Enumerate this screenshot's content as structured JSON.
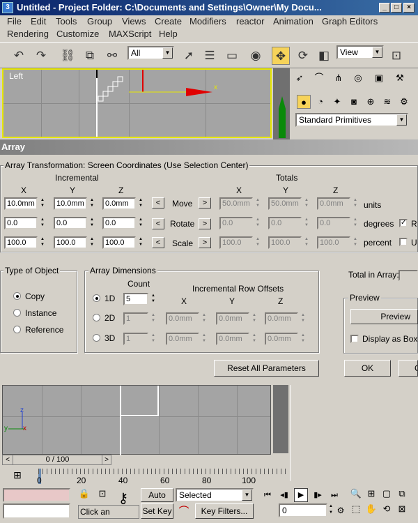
{
  "window": {
    "title": "Untitled    - Project Folder: C:\\Documents and Settings\\Owner\\My Docu..."
  },
  "menu": [
    "File",
    "Edit",
    "Tools",
    "Group",
    "Views",
    "Create",
    "Modifiers",
    "reactor",
    "Animation",
    "Graph Editors",
    "Rendering",
    "Customize",
    "MAXScript",
    "Help"
  ],
  "toolbar": {
    "selection_filter": "All",
    "ref_coord": "View"
  },
  "viewport_top": {
    "label": "Left"
  },
  "command_panel": {
    "dropdown": "Standard Primitives"
  },
  "dialog": {
    "title": "Array",
    "transform_group": "Array Transformation: Screen Coordinates (Use Selection Center)",
    "incremental_label": "Incremental",
    "totals_label": "Totals",
    "axes": [
      "X",
      "Y",
      "Z"
    ],
    "rows": [
      {
        "label": "Move",
        "inc": [
          "10.0mm",
          "10.0mm",
          "0.0mm"
        ],
        "tot": [
          "50.0mm",
          "50.0mm",
          "0.0mm"
        ],
        "unit": "units"
      },
      {
        "label": "Rotate",
        "inc": [
          "0.0",
          "0.0",
          "0.0"
        ],
        "tot": [
          "0.0",
          "0.0",
          "0.0"
        ],
        "unit": "degrees"
      },
      {
        "label": "Scale",
        "inc": [
          "100.0",
          "100.0",
          "100.0"
        ],
        "tot": [
          "100.0",
          "100.0",
          "100.0"
        ],
        "unit": "percent"
      }
    ],
    "re_orient_label": "R",
    "uniform_label": "U",
    "type_group": "Type of Object",
    "type_options": [
      "Copy",
      "Instance",
      "Reference"
    ],
    "dims_group": "Array Dimensions",
    "count_label": "Count",
    "row_offsets_label": "Incremental Row Offsets",
    "dims": [
      {
        "label": "1D",
        "count": "5"
      },
      {
        "label": "2D",
        "count": "1",
        "x": "0.0mm",
        "y": "0.0mm",
        "z": "0.0mm"
      },
      {
        "label": "3D",
        "count": "1",
        "x": "0.0mm",
        "y": "0.0mm",
        "z": "0.0mm"
      }
    ],
    "total_in_array": "Total in Array:",
    "preview_group": "Preview",
    "preview_button": "Preview",
    "display_as_box": "Display as Box",
    "reset_button": "Reset All Parameters",
    "ok_button": "OK",
    "cancel_fragment": "C"
  },
  "time_slider": {
    "value": "0 / 100"
  },
  "timeline_ticks": [
    "0",
    "20",
    "40",
    "60",
    "80",
    "100"
  ],
  "status": {
    "auto_key": "Auto Key",
    "set_key": "Set Key",
    "selected": "Selected",
    "key_filters": "Key Filters...",
    "frame": "0",
    "prompt": "Click an"
  },
  "colors": {
    "title_active": "#0a246a",
    "viewport_border": "#e8e800",
    "move_arrow": "#e00000",
    "select_highlight": "#f6d35a"
  }
}
